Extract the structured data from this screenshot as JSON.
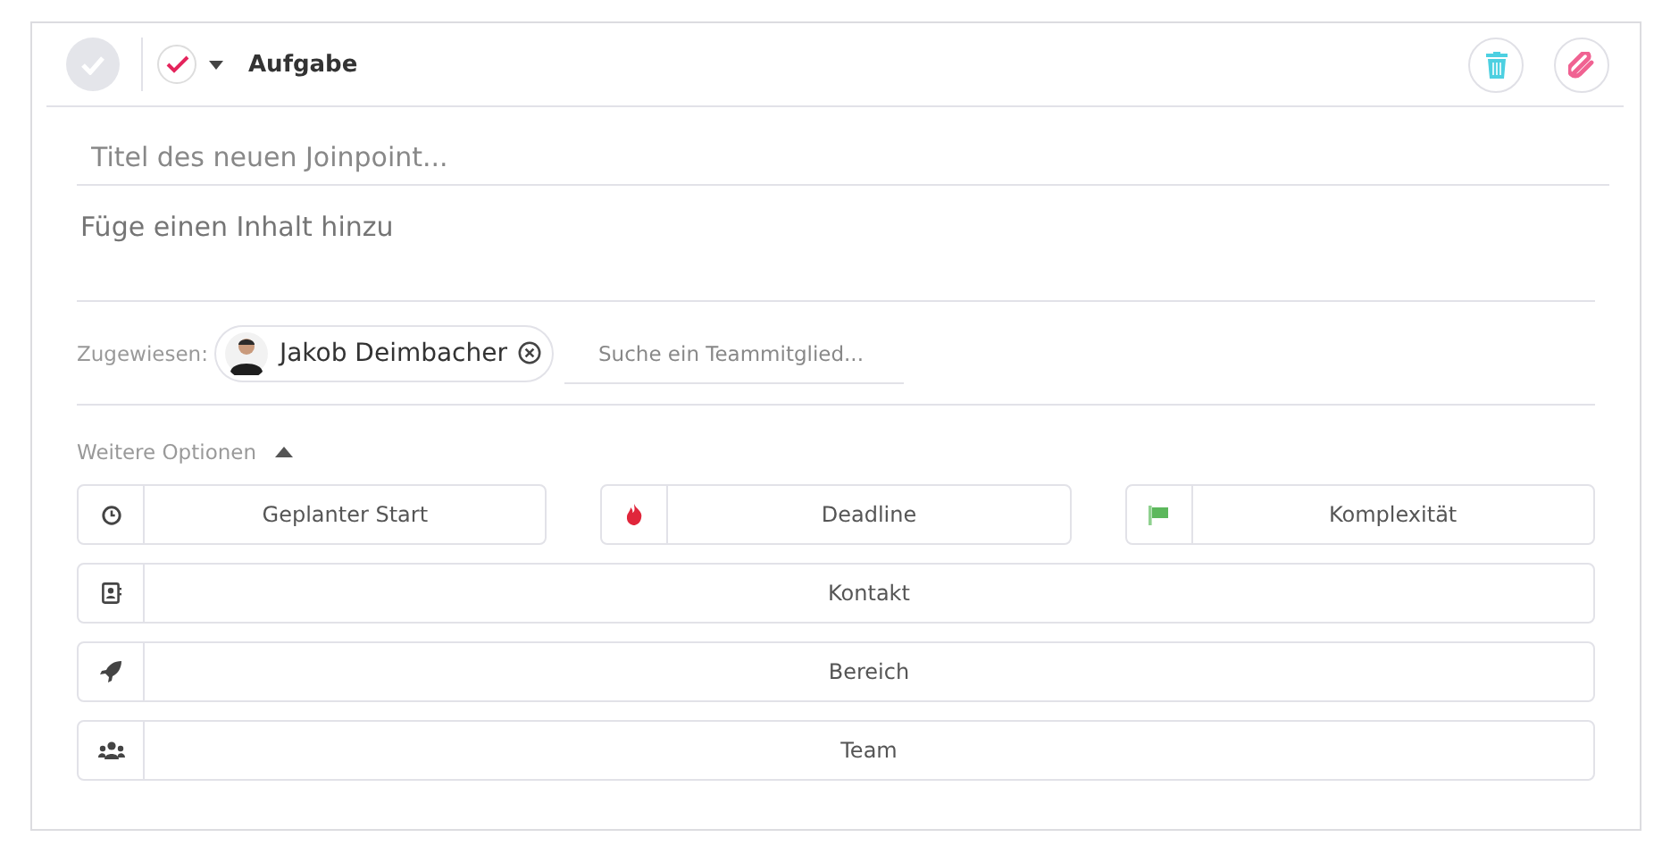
{
  "header": {
    "completed": false,
    "type_label": "Aufgabe"
  },
  "title_field": {
    "placeholder": "Titel des neuen Joinpoint..."
  },
  "content_field": {
    "placeholder": "Füge einen Inhalt hinzu"
  },
  "assigned": {
    "label": "Zugewiesen:",
    "members": [
      {
        "name": "Jakob Deimbacher"
      }
    ],
    "search_placeholder": "Suche ein Teammitglied..."
  },
  "more_options": {
    "label": "Weitere Optionen",
    "expanded": true
  },
  "option_rows": [
    [
      {
        "kind": "clock",
        "label": "Geplanter Start"
      },
      {
        "kind": "fire",
        "label": "Deadline"
      },
      {
        "kind": "flag",
        "label": "Komplexität"
      }
    ],
    [
      {
        "kind": "contact",
        "label": "Kontakt"
      }
    ],
    [
      {
        "kind": "rocket",
        "label": "Bereich"
      }
    ],
    [
      {
        "kind": "team",
        "label": "Team"
      }
    ]
  ]
}
